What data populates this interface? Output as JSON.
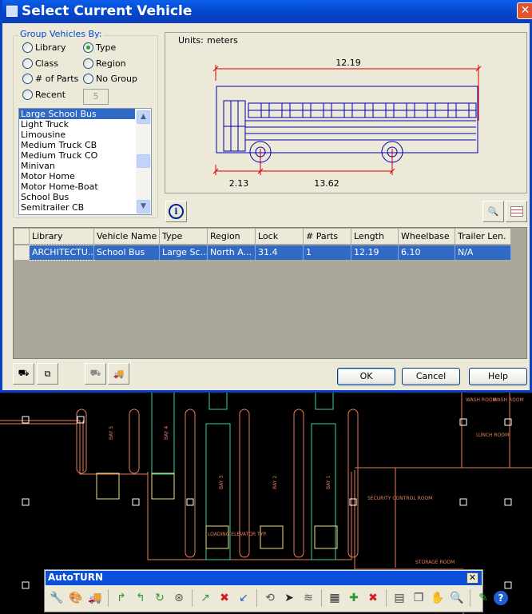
{
  "dialog": {
    "title": "Select Current Vehicle",
    "close": "✕"
  },
  "group": {
    "legend": "Group Vehicles By:",
    "options": [
      {
        "label": "Library",
        "selected": false
      },
      {
        "label": "Type",
        "selected": true
      },
      {
        "label": "Class",
        "selected": false
      },
      {
        "label": "Region",
        "selected": false
      },
      {
        "label": "# of Parts",
        "selected": false
      },
      {
        "label": "No Group",
        "selected": false
      },
      {
        "label": "Recent",
        "selected": false
      }
    ],
    "recent_count": "5"
  },
  "vehicle_list": {
    "items": [
      "Large School Bus",
      "Light Truck",
      "Limousine",
      "Medium Truck CB",
      "Medium Truck CO",
      "Minivan",
      "Motor Home",
      "Motor Home-Boat",
      "School Bus",
      "Semitrailer CB"
    ],
    "selected": "Large School Bus"
  },
  "preview": {
    "units_label": "Units:",
    "units": "meters",
    "length": "12.19",
    "front_overhang": "2.13",
    "wheelbase_dim": "13.62",
    "colors": {
      "vehicle": "#0000B0",
      "dimension": "#E00000"
    }
  },
  "table": {
    "columns": [
      "Library",
      "Vehicle Name",
      "Type",
      "Region",
      "Lock",
      "# Parts",
      "Length",
      "Wheelbase",
      "Trailer Len."
    ],
    "rows": [
      [
        "ARCHITECTU...",
        "School Bus",
        "Large Sc...",
        "North A...",
        "31.4",
        "1",
        "12.19",
        "6.10",
        "N/A"
      ]
    ]
  },
  "buttons": {
    "ok": "OK",
    "cancel": "Cancel",
    "help": "Help"
  },
  "cad": {
    "labels": [
      "BAY 5",
      "BAY 4",
      "BAY 3",
      "BAY 2",
      "BAY 1",
      "LOADING ELEVATOR TYP.",
      "SECURITY CONTROL ROOM",
      "STORAGE ROOM",
      "LUNCH ROOM",
      "WASH ROOM",
      "WASH ROOM"
    ]
  },
  "toolbar": {
    "title": "AutoTURN",
    "close": "✕",
    "icons": [
      "wrench-icon",
      "palette-icon",
      "vehicle-icon",
      "|",
      "arc-path-icon",
      "arc-path-2-icon",
      "arc-path-3-icon",
      "steering-wheel-icon",
      "|",
      "edit-path-icon",
      "delete-path-icon",
      "reverse-path-icon",
      "|",
      "swept-path-icon",
      "select-arrow-icon",
      "tracks-icon",
      "|",
      "animation-icon",
      "add-icon",
      "remove-icon",
      "|",
      "report-icon",
      "copy-icon",
      "library-icon",
      "search-doc-icon",
      "|",
      "edit-doc-icon",
      "help-icon"
    ]
  }
}
